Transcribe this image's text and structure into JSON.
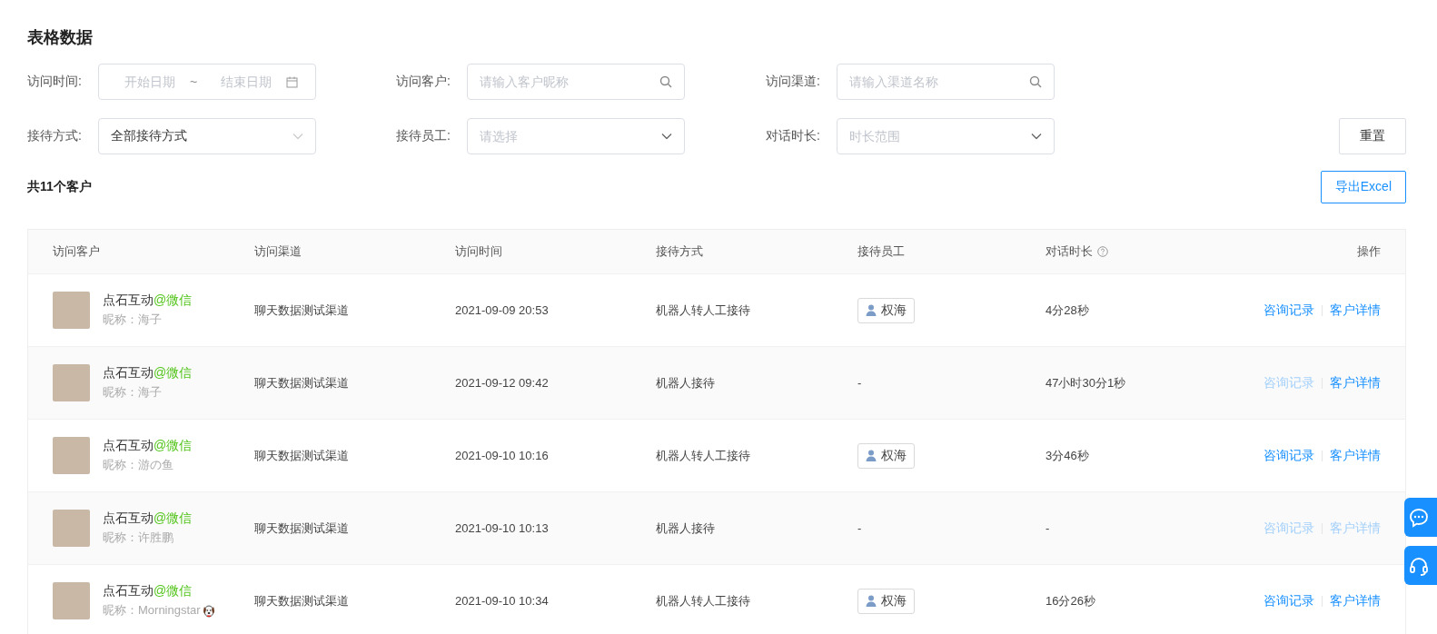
{
  "page_title": "表格数据",
  "filters": [
    {
      "label": "访问时间:",
      "kind": "daterange",
      "start_placeholder": "开始日期",
      "separator": "~",
      "end_placeholder": "结束日期"
    },
    {
      "label": "访问客户:",
      "kind": "search",
      "placeholder": "请输入客户昵称"
    },
    {
      "label": "访问渠道:",
      "kind": "search",
      "placeholder": "请输入渠道名称"
    },
    {
      "label": "接待方式:",
      "kind": "select",
      "value": "全部接待方式"
    },
    {
      "label": "接待员工:",
      "kind": "select",
      "placeholder": "请选择"
    },
    {
      "label": "对话时长:",
      "kind": "select",
      "placeholder": "时长范围"
    }
  ],
  "reset_button": "重置",
  "total": "共11个客户",
  "export_button": "导出Excel",
  "table": {
    "columns": [
      "访问客户",
      "访问渠道",
      "访问时间",
      "接待方式",
      "接待员工",
      "对话时长",
      "操作"
    ],
    "rows": [
      {
        "name": "点石互动",
        "source": "@微信",
        "nickname": "昵称：海子",
        "nickname_badge": false,
        "channel": "聊天数据测试渠道",
        "time": "2021-09-09 20:53",
        "mode": "机器人转人工接待",
        "staff": {
          "kind": "tag",
          "text": "权海"
        },
        "duration": "4分28秒",
        "actions": [
          {
            "label": "咨询记录",
            "disabled": false
          },
          {
            "label": "客户详情",
            "disabled": false
          }
        ]
      },
      {
        "name": "点石互动",
        "source": "@微信",
        "nickname": "昵称：海子",
        "nickname_badge": false,
        "channel": "聊天数据测试渠道",
        "time": "2021-09-12 09:42",
        "mode": "机器人接待",
        "staff": {
          "kind": "text",
          "text": "-"
        },
        "duration": "47小时30分1秒",
        "actions": [
          {
            "label": "咨询记录",
            "disabled": true
          },
          {
            "label": "客户详情",
            "disabled": false
          }
        ]
      },
      {
        "name": "点石互动",
        "source": "@微信",
        "nickname": "昵称：游の鱼",
        "nickname_badge": false,
        "channel": "聊天数据测试渠道",
        "time": "2021-09-10 10:16",
        "mode": "机器人转人工接待",
        "staff": {
          "kind": "tag",
          "text": "权海"
        },
        "duration": "3分46秒",
        "actions": [
          {
            "label": "咨询记录",
            "disabled": false
          },
          {
            "label": "客户详情",
            "disabled": false
          }
        ]
      },
      {
        "name": "点石互动",
        "source": "@微信",
        "nickname": "昵称：许胜鹏",
        "nickname_badge": false,
        "channel": "聊天数据测试渠道",
        "time": "2021-09-10 10:13",
        "mode": "机器人接待",
        "staff": {
          "kind": "text",
          "text": "-"
        },
        "duration": "-",
        "actions": [
          {
            "label": "咨询记录",
            "disabled": true
          },
          {
            "label": "客户详情",
            "disabled": true
          }
        ]
      },
      {
        "name": "点石互动",
        "source": "@微信",
        "nickname": "昵称：Morningstar",
        "nickname_badge": true,
        "channel": "聊天数据测试渠道",
        "time": "2021-09-10 10:34",
        "mode": "机器人转人工接待",
        "staff": {
          "kind": "tag",
          "text": "权海"
        },
        "duration": "16分26秒",
        "actions": [
          {
            "label": "咨询记录",
            "disabled": false
          },
          {
            "label": "客户详情",
            "disabled": false
          }
        ]
      }
    ]
  }
}
